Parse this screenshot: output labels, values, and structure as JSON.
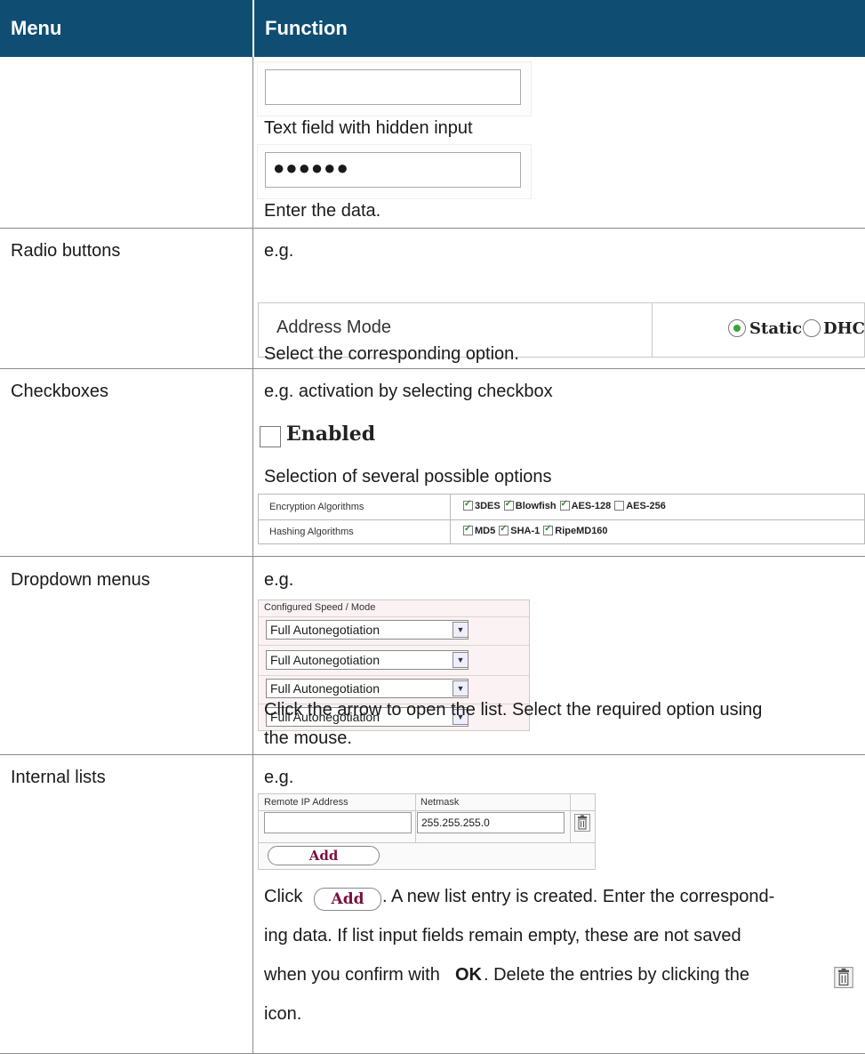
{
  "header": {
    "menu": "Menu",
    "function": "Function"
  },
  "rows": {
    "text": {
      "hidden_caption": "Text field with hidden input",
      "hidden_value": "●●●●●●",
      "enter": "Enter the data."
    },
    "radio": {
      "menu": "Radio buttons",
      "eg": "e.g.",
      "field_label": "Address Mode",
      "opt1": "Static",
      "opt2": "DHCP",
      "select": "Select the corresponding option."
    },
    "checkbox": {
      "menu": "Checkboxes",
      "eg": "e.g. activation by selecting checkbox",
      "enabled": "Enabled",
      "several": "Selection of several possible options",
      "enc_label": "Encryption Algorithms",
      "enc_opts": [
        "3DES",
        "Blowfish",
        "AES-128",
        "AES-256"
      ],
      "enc_checked": [
        true,
        true,
        true,
        false
      ],
      "hash_label": "Hashing Algorithms",
      "hash_opts": [
        "MD5",
        "SHA-1",
        "RipeMD160"
      ],
      "hash_checked": [
        true,
        true,
        true
      ]
    },
    "dropdown": {
      "menu": "Dropdown menus",
      "eg": "e.g.",
      "header": "Configured Speed / Mode",
      "options": [
        "Full Autonegotiation",
        "Full Autonegotiation",
        "Full Autonegotiation",
        "Full Autonegotiation"
      ],
      "desc1": "Click the arrow to open the list. Select the required option using",
      "desc2": "the mouse."
    },
    "internal": {
      "menu": "Internal lists",
      "eg": "e.g.",
      "col1": "Remote IP Address",
      "col2": "Netmask",
      "ip_value": "",
      "netmask_value": "255.255.255.0",
      "add": "Add",
      "p1a": "Click",
      "p1b": ". A new list entry is created. Enter the correspond-",
      "p2": "ing data. If list input fields remain empty, these are not saved",
      "p3a": "when you confirm with",
      "p3b": "OK",
      "p3c": ". Delete the entries by clicking the",
      "p4": "icon."
    }
  }
}
